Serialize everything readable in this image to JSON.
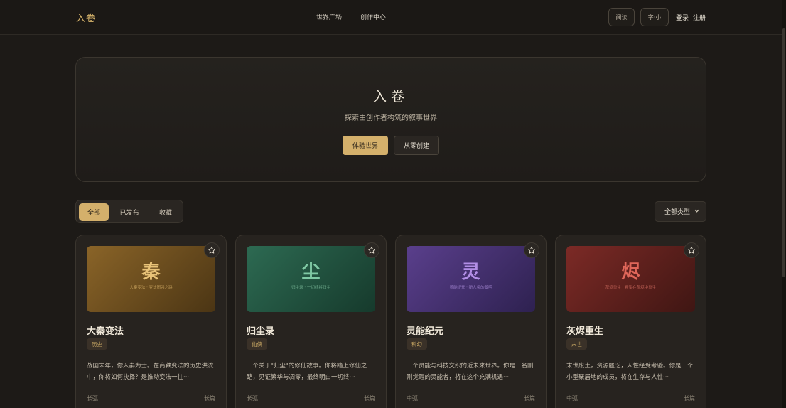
{
  "nav": {
    "brand": "入卷",
    "links": [
      "世界广场",
      "创作中心"
    ],
    "read_label": "阅读",
    "font_label": "字·小",
    "login_label": "登录",
    "register_label": "注册"
  },
  "hero": {
    "title": "入卷",
    "subtitle": "探索由创作者构筑的叙事世界",
    "primary_label": "体验世界",
    "secondary_label": "从零创建"
  },
  "filters": {
    "tabs": [
      "全部",
      "已发布",
      "收藏"
    ],
    "active_tab": "全部",
    "type_select": "全部类型"
  },
  "cards": [
    {
      "glyph": "秦",
      "cover_tag": "大秦变法 · 变法图强之路",
      "title": "大秦变法",
      "genre": "历史",
      "description": "战国末年，你入秦为士。在商鞅变法的历史洪流中，你将如何抉择？是推动变法一往···",
      "length_l": "长弧",
      "length_r": "长篇",
      "colors": {
        "bg_from": "#8a6428",
        "bg_to": "#4b3514",
        "glyph": "#e8c278",
        "tag": "#caa45f"
      }
    },
    {
      "glyph": "尘",
      "cover_tag": "归尘录 · 一切终将归尘",
      "title": "归尘录",
      "genre": "仙侠",
      "description": "一个关于\"归尘\"的修仙故事。你将踏上修仙之路，见证繁华与凋零，最终明白一切终···",
      "length_l": "长弧",
      "length_r": "长篇",
      "colors": {
        "bg_from": "#2d6a52",
        "bg_to": "#163a2c",
        "glyph": "#7fc9a4",
        "tag": "#79b797"
      }
    },
    {
      "glyph": "灵",
      "cover_tag": "灵能纪元 · 新人类的黎明",
      "title": "灵能纪元",
      "genre": "科幻",
      "description": "一个灵能与科技交织的近未来世界。你是一名刚刚觉醒的灵能者，将在这个充满机遇···",
      "length_l": "中弧",
      "length_r": "长篇",
      "colors": {
        "bg_from": "#5a3f8c",
        "bg_to": "#2e2150",
        "glyph": "#b28ee6",
        "tag": "#a88ad6"
      }
    },
    {
      "glyph": "烬",
      "cover_tag": "灰烬重生 · 希望在灰烬中重生",
      "title": "灰烬重生",
      "genre": "末世",
      "description": "末世废土，资源匮乏，人性经受考验。你是一个小型聚居地的成员，将在生存与人性···",
      "length_l": "中弧",
      "length_r": "长篇",
      "colors": {
        "bg_from": "#7c2a26",
        "bg_to": "#3f1613",
        "glyph": "#e0675a",
        "tag": "#cf6b5f"
      }
    }
  ]
}
